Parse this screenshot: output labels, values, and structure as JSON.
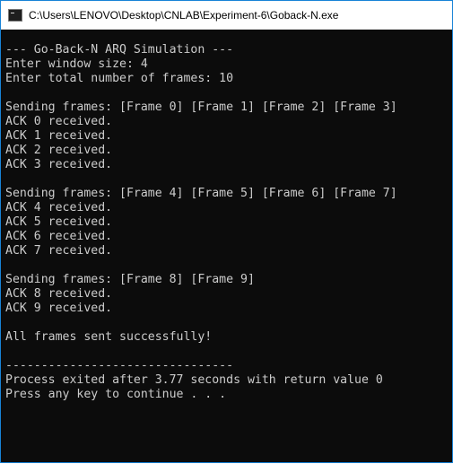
{
  "window": {
    "title": "C:\\Users\\LENOVO\\Desktop\\CNLAB\\Experiment-6\\Goback-N.exe",
    "icon": "console-app-icon"
  },
  "console": {
    "lines": [
      "--- Go-Back-N ARQ Simulation ---",
      "Enter window size: 4",
      "Enter total number of frames: 10",
      "",
      "Sending frames: [Frame 0] [Frame 1] [Frame 2] [Frame 3]",
      "ACK 0 received.",
      "ACK 1 received.",
      "ACK 2 received.",
      "ACK 3 received.",
      "",
      "Sending frames: [Frame 4] [Frame 5] [Frame 6] [Frame 7]",
      "ACK 4 received.",
      "ACK 5 received.",
      "ACK 6 received.",
      "ACK 7 received.",
      "",
      "Sending frames: [Frame 8] [Frame 9]",
      "ACK 8 received.",
      "ACK 9 received.",
      "",
      "All frames sent successfully!",
      "",
      "--------------------------------",
      "Process exited after 3.77 seconds with return value 0",
      "Press any key to continue . . ."
    ]
  },
  "colors": {
    "background": "#0c0c0c",
    "text": "#cccccc",
    "titlebar": "#ffffff",
    "border": "#1883d7"
  }
}
